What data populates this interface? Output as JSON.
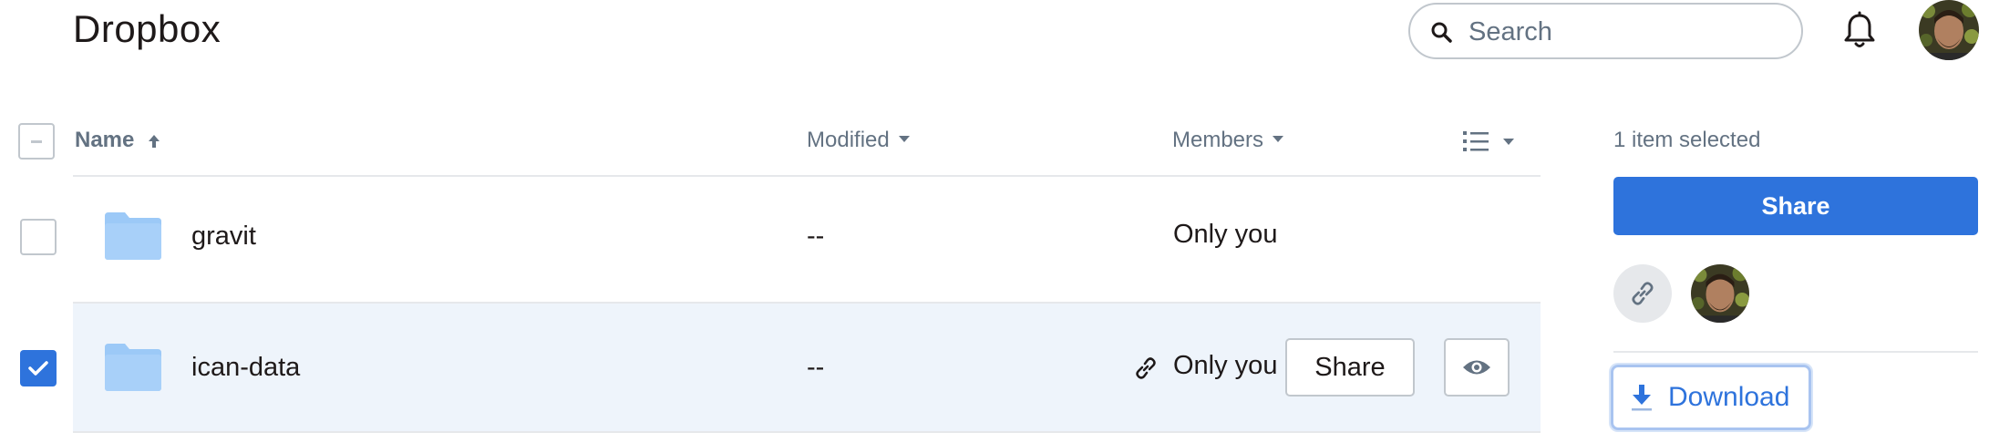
{
  "app": {
    "title": "Dropbox"
  },
  "search": {
    "placeholder": "Search",
    "value": ""
  },
  "icons": {
    "search": "search-icon",
    "bell": "bell-icon",
    "avatar": "user-avatar",
    "folder": "folder-icon",
    "link": "link-icon",
    "eye": "eye-icon",
    "list_view": "list-view-icon",
    "download": "download-icon",
    "sort_up": "sort-ascending-icon",
    "check": "check-icon"
  },
  "table": {
    "columns": {
      "name": "Name",
      "modified": "Modified",
      "members": "Members"
    },
    "rows": [
      {
        "name": "gravit",
        "modified": "--",
        "members": "Only you",
        "selected": false
      },
      {
        "name": "ican-data",
        "modified": "--",
        "members": "Only you",
        "selected": true,
        "share_label": "Share"
      }
    ]
  },
  "panel": {
    "selection_text": "1 item selected",
    "share_label": "Share",
    "download_label": "Download"
  },
  "colors": {
    "accent": "#2e73dc",
    "folder": "#9cc9f7",
    "selected_row": "#eef4fb",
    "muted_text": "#637282",
    "border": "#c1c7cd"
  }
}
